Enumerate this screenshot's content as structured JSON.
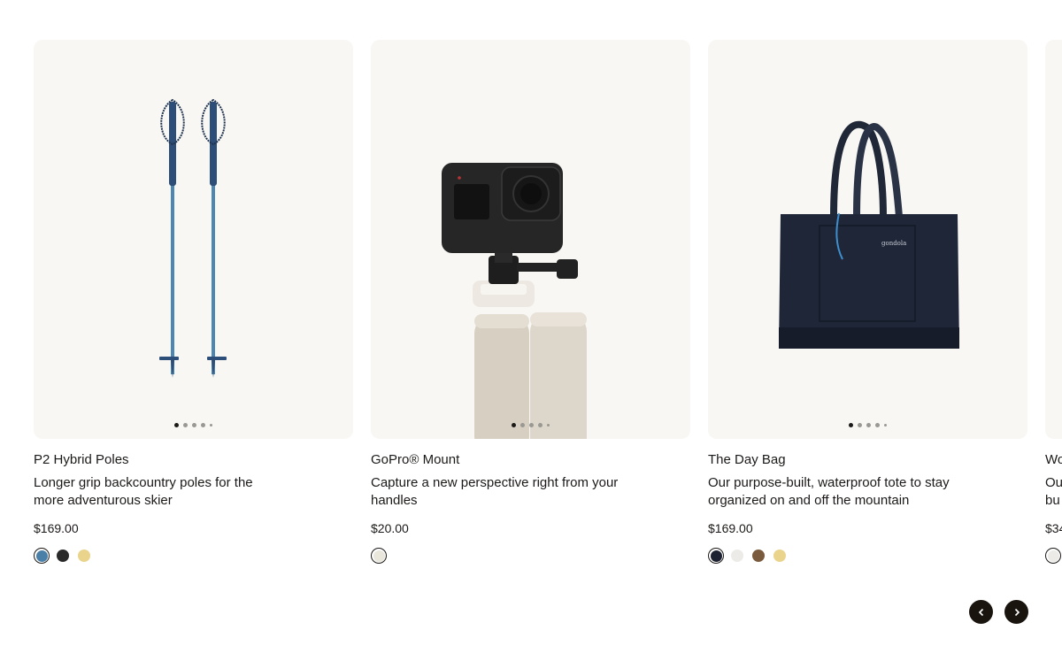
{
  "products": [
    {
      "name": "P2 Hybrid Poles",
      "description": "Longer grip backcountry poles for the more adventurous skier",
      "price": "$169.00",
      "image_icon": "ski-poles-image",
      "swatches": [
        {
          "color": "#4a7fa8",
          "label": "blue",
          "selected": true
        },
        {
          "color": "#2a2a2a",
          "label": "black",
          "selected": false
        },
        {
          "color": "#ead48c",
          "label": "yellow",
          "selected": false
        }
      ]
    },
    {
      "name": "GoPro® Mount",
      "description": "Capture a new perspective right from your handles",
      "price": "$20.00",
      "image_icon": "gopro-mount-image",
      "swatches": [
        {
          "color": "#e9e6dc",
          "label": "stone",
          "selected": true
        }
      ]
    },
    {
      "name": "The Day Bag",
      "description": "Our purpose-built, waterproof tote to stay organized on and off the mountain",
      "price": "$169.00",
      "image_icon": "tote-bag-image",
      "swatches": [
        {
          "color": "#1d2232",
          "label": "navy",
          "selected": true
        },
        {
          "color": "#ecebe8",
          "label": "white",
          "selected": false
        },
        {
          "color": "#7a5a3c",
          "label": "brown",
          "selected": false
        },
        {
          "color": "#ead48c",
          "label": "yellow",
          "selected": false
        }
      ]
    },
    {
      "name": "Wo",
      "description": "Ou bu",
      "price": "$34",
      "image_icon": "product-image",
      "swatches": [
        {
          "color": "#ecebe8",
          "label": "white",
          "selected": true
        }
      ]
    }
  ],
  "carousel": {
    "prev_icon": "chevron-left-icon",
    "next_icon": "chevron-right-icon"
  },
  "colors": {
    "card_background": "#f8f7f3",
    "button": "#1a140e",
    "text": "#1c1a18"
  }
}
